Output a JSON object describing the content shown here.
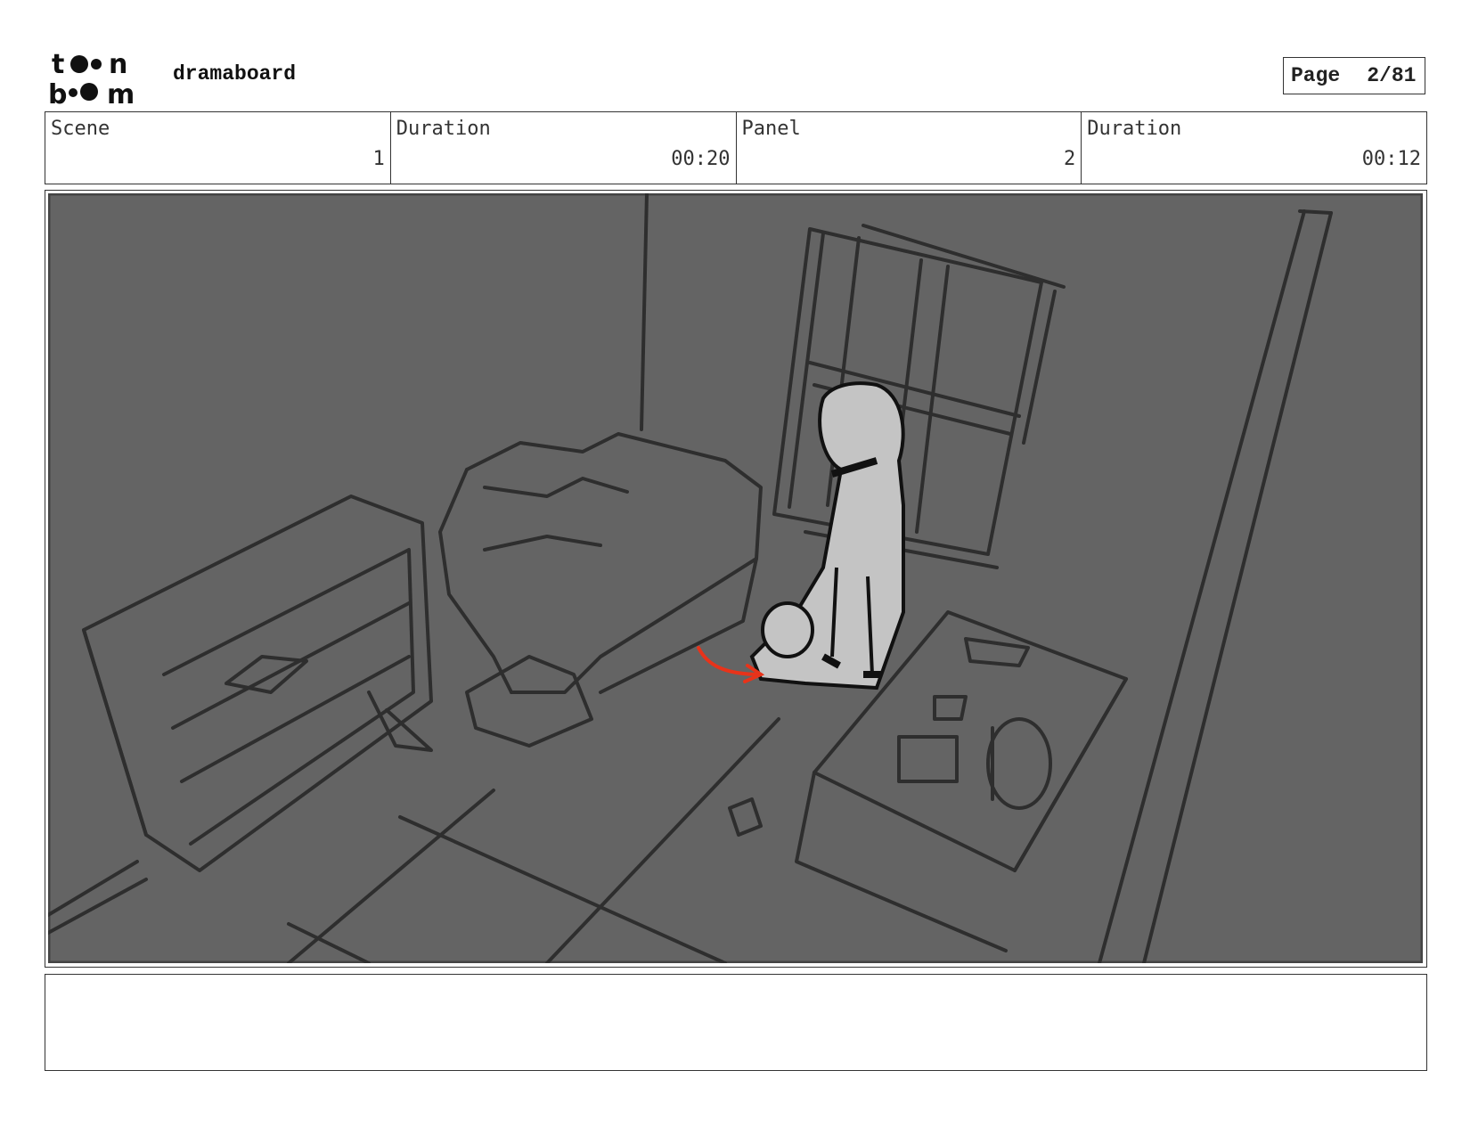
{
  "header": {
    "logo_text": "toon boom",
    "app_name": "dramaboard",
    "page_label": "Page",
    "page_value": "2/81"
  },
  "info": {
    "scene_label": "Scene",
    "scene_value": "1",
    "scene_duration_label": "Duration",
    "scene_duration_value": "00:20",
    "panel_label": "Panel",
    "panel_value": "2",
    "panel_duration_label": "Duration",
    "panel_duration_value": "00:12"
  },
  "panel": {
    "background_color": "#646464",
    "line_color": "#2e2e2e",
    "figure_fill": "#c4c4c4",
    "action_arrow_color": "#e8331a"
  },
  "notes": {
    "text": ""
  }
}
